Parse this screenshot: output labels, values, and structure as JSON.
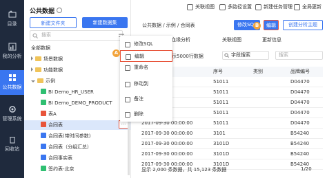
{
  "topbar": {
    "items": [
      "关联视图",
      "多路径设置",
      "新建任务管理",
      "全局更新"
    ]
  },
  "sidebar": {
    "items": [
      {
        "label": "目录",
        "icon": "folder-icon"
      },
      {
        "label": "我的分析",
        "icon": "chart-icon"
      },
      {
        "label": "公共数据",
        "icon": "database-icon"
      },
      {
        "label": "管理系统",
        "icon": "gear-icon"
      },
      {
        "label": "回收站",
        "icon": "trash-icon"
      }
    ]
  },
  "panel": {
    "title": "公共数据",
    "new_folder": "新建文件夹",
    "new_dataset": "新建数据集",
    "search_placeholder": "搜索",
    "tree": [
      {
        "label": "全部数据",
        "level": 0,
        "type": "root"
      },
      {
        "label": "场景数据",
        "level": 1,
        "type": "folder"
      },
      {
        "label": "功能数据",
        "level": 1,
        "type": "folder"
      },
      {
        "label": "示例",
        "level": 1,
        "type": "folder-open"
      },
      {
        "label": "BI Demo_HR_USER",
        "level": 2,
        "type": "db"
      },
      {
        "label": "BI Demo_DEMO_PRODUCT",
        "level": 2,
        "type": "db"
      },
      {
        "label": "表A",
        "level": 2,
        "type": "table"
      },
      {
        "label": "合同表",
        "level": 2,
        "type": "table"
      },
      {
        "label": "合同表(带时间参数)",
        "level": 2,
        "type": "table"
      },
      {
        "label": "合同表（分组汇总）",
        "level": 2,
        "type": "table"
      },
      {
        "label": "合同事实表",
        "level": 2,
        "type": "table"
      },
      {
        "label": "签约表-北京",
        "level": 2,
        "type": "table"
      }
    ]
  },
  "context_menu": {
    "items": [
      {
        "label": "修改SQL",
        "icon": "sql-icon"
      },
      {
        "label": "编辑",
        "icon": "edit-icon"
      },
      {
        "label": "重命名",
        "icon": "rename-icon"
      },
      {
        "label": "移动到",
        "icon": "move-icon"
      },
      {
        "label": "备注",
        "icon": "note-icon"
      },
      {
        "label": "删除",
        "icon": "delete-icon"
      }
    ],
    "more_button": "···"
  },
  "main": {
    "breadcrumb": "公共数据  /  示例  /  合同表",
    "edit_sql": "修改SQL",
    "edit": "编辑",
    "create_theme": "创建分析主题",
    "tabs": [
      "血缘分析",
      "关联视图",
      "更新信息"
    ],
    "data_note": "显示5000行数据",
    "field_search": "字段搜索",
    "columns": [
      "",
      "序号",
      "类别",
      "品牌编号"
    ],
    "rows": [
      [
        "",
        "51011",
        "",
        "D04470"
      ],
      [
        "",
        "51011",
        "",
        "D04470"
      ],
      [
        "",
        "51011",
        "",
        "D04470"
      ],
      [
        "",
        "51011",
        "",
        "D04470"
      ],
      [
        "2017-09-30 00:00:00",
        "51011",
        "",
        "D04470"
      ],
      [
        "2017-09-30 00:00:00",
        "3101",
        "",
        "B54240"
      ],
      [
        "2017-09-30 00:00:00",
        "3101D",
        "",
        "B54240"
      ],
      [
        "2017-09-30 00:00:00",
        "3101D",
        "",
        "B54240"
      ],
      [
        "2017-09-30 00:00:00",
        "3101D",
        "",
        "B54240"
      ]
    ],
    "footer": "显示 2,000 条数据，共 15,123 条数据",
    "page": "1/20"
  },
  "badges": {
    "a": "A",
    "b": "B"
  }
}
